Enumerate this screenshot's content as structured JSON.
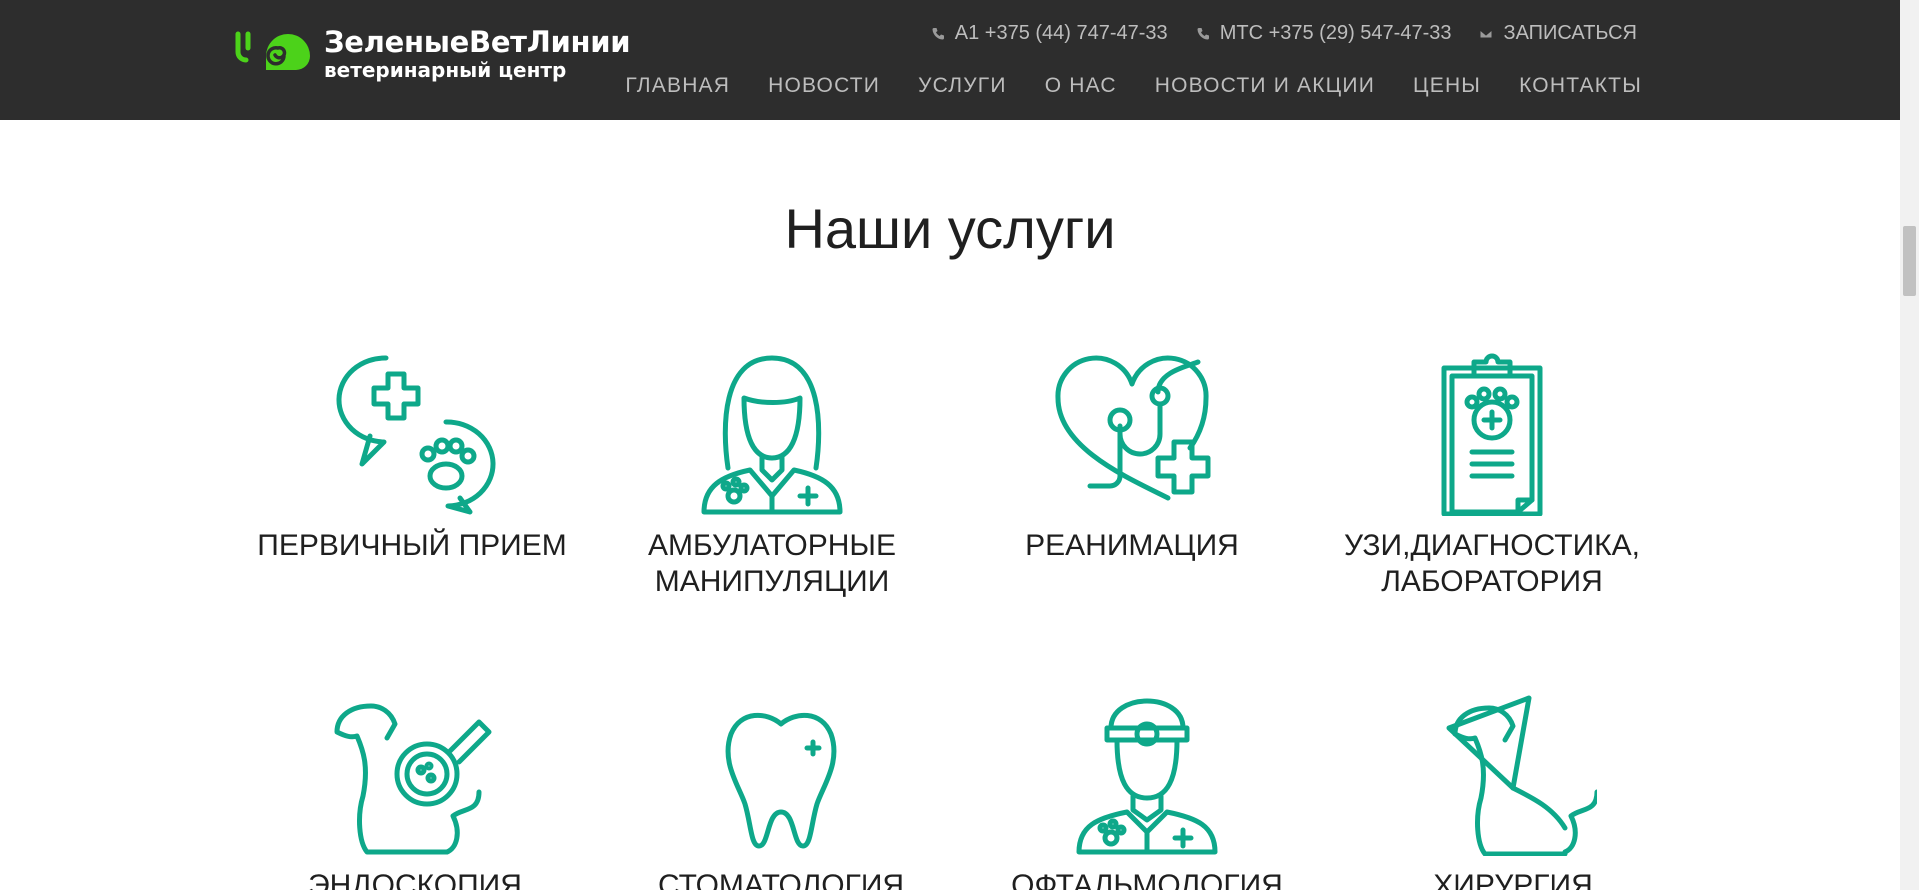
{
  "header": {
    "logo": {
      "name": "ЗеленыеВетЛинии",
      "subtitle": "ветеринарный центр",
      "brand_color": "#4cd21a"
    },
    "contacts": [
      {
        "icon": "phone-icon",
        "text": "А1 +375 (44) 747-47-33"
      },
      {
        "icon": "phone-icon",
        "text": "МТС +375 (29) 547-47-33"
      },
      {
        "icon": "envelope-icon",
        "text": "ЗАПИСАТЬСЯ"
      }
    ],
    "nav": [
      {
        "label": "ГЛАВНАЯ"
      },
      {
        "label": "НОВОСТИ"
      },
      {
        "label": "УСЛУГИ"
      },
      {
        "label": "О НАС"
      },
      {
        "label": "НОВОСТИ И АКЦИИ"
      },
      {
        "label": "ЦЕНЫ"
      },
      {
        "label": "КОНТАКТЫ"
      }
    ]
  },
  "main": {
    "title": "Наши услуги",
    "accent_color": "#0ea88a",
    "services": [
      {
        "icon": "chat-cross-paw-icon",
        "label": "ПЕРВИЧНЫЙ ПРИЕМ"
      },
      {
        "icon": "vet-woman-icon",
        "label": "АМБУЛАТОРНЫЕ МАНИПУЛЯЦИИ"
      },
      {
        "icon": "heart-stethoscope-icon",
        "label": "РЕАНИМАЦИЯ"
      },
      {
        "icon": "clipboard-paw-icon",
        "label": "УЗИ,ДИАГНОСТИКА, ЛАБОРАТОРИЯ"
      },
      {
        "icon": "dog-magnifier-icon",
        "label": "ЭНДОСКОПИЯ"
      },
      {
        "icon": "tooth-icon",
        "label": "СТОМАТОЛОГИЯ"
      },
      {
        "icon": "doctor-head-mirror-icon",
        "label": "ОФТАЛЬМОЛОГИЯ"
      },
      {
        "icon": "dog-cone-icon",
        "label": "ХИРУРГИЯ"
      }
    ]
  }
}
